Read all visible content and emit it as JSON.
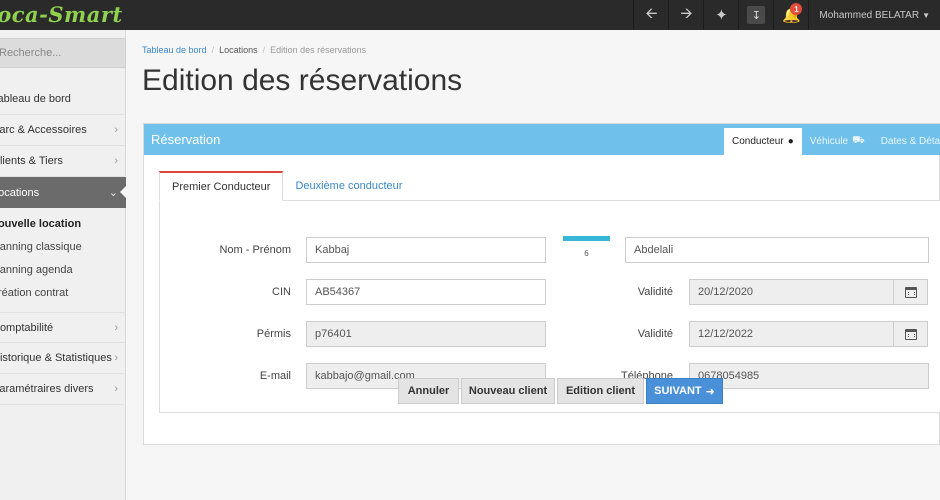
{
  "app": {
    "logo_text": "Loca-Smart"
  },
  "topbar": {
    "icons": [
      "arrow-left-icon",
      "arrow-right-icon",
      "magic-wand-icon",
      "download-icon",
      "bell-icon"
    ],
    "notification_count": "1",
    "user_name": "Mohammed BELATAR"
  },
  "sidebar": {
    "search_placeholder": "Recherche...",
    "items": [
      {
        "label": "Tableau de bord",
        "has_children": false
      },
      {
        "label": "Parc & Accessoires",
        "has_children": true
      },
      {
        "label": "Clients & Tiers",
        "has_children": true
      },
      {
        "label": "Locations",
        "has_children": true,
        "active": true
      },
      {
        "label": "Comptabilité",
        "has_children": true
      },
      {
        "label": "Historique & Statistiques",
        "has_children": true
      },
      {
        "label": "Paramétraires divers",
        "has_children": true
      }
    ],
    "sub_items": [
      "Nouvelle location",
      "Planning classique",
      "Planning agenda",
      "Création contrat"
    ]
  },
  "breadcrumb": [
    "Tableau de bord",
    "Locations",
    "Edition des réservations"
  ],
  "page_title": "Edition des réservations",
  "panel": {
    "title": "Réservation",
    "tabs": [
      {
        "label": "Conducteur",
        "icon": "user-icon",
        "active": true
      },
      {
        "label": "Véhicule",
        "icon": "truck-icon"
      },
      {
        "label": "Dates & Détails",
        "icon": ""
      }
    ],
    "inner_tabs": [
      {
        "label": "Premier Conducteur",
        "active": true
      },
      {
        "label": "Deuxième conducteur"
      }
    ],
    "progress_count": "6",
    "progress_fraction": 1.0
  },
  "form": {
    "name_label": "Nom - Prénom",
    "last_name": "Kabbaj",
    "first_name": "Abdelali",
    "cin_label": "CIN",
    "cin": "AB54367",
    "validity_label": "Validité",
    "cin_validity": "20/12/2020",
    "permis_label": "Pérmis",
    "permis": "p76401",
    "permis_validity": "12/12/2022",
    "email_label": "E-mail",
    "email": "kabbajo@gmail.com",
    "phone_label": "Téléphone",
    "phone": "0678054985"
  },
  "buttons": {
    "cancel": "Annuler",
    "new_client": "Nouveau client",
    "edit_client": "Edition client",
    "next": "SUIVANT"
  },
  "colors": {
    "panel_header": "#6fc0ea",
    "primary": "#4a90d9",
    "accent_red": "#d9453a"
  }
}
